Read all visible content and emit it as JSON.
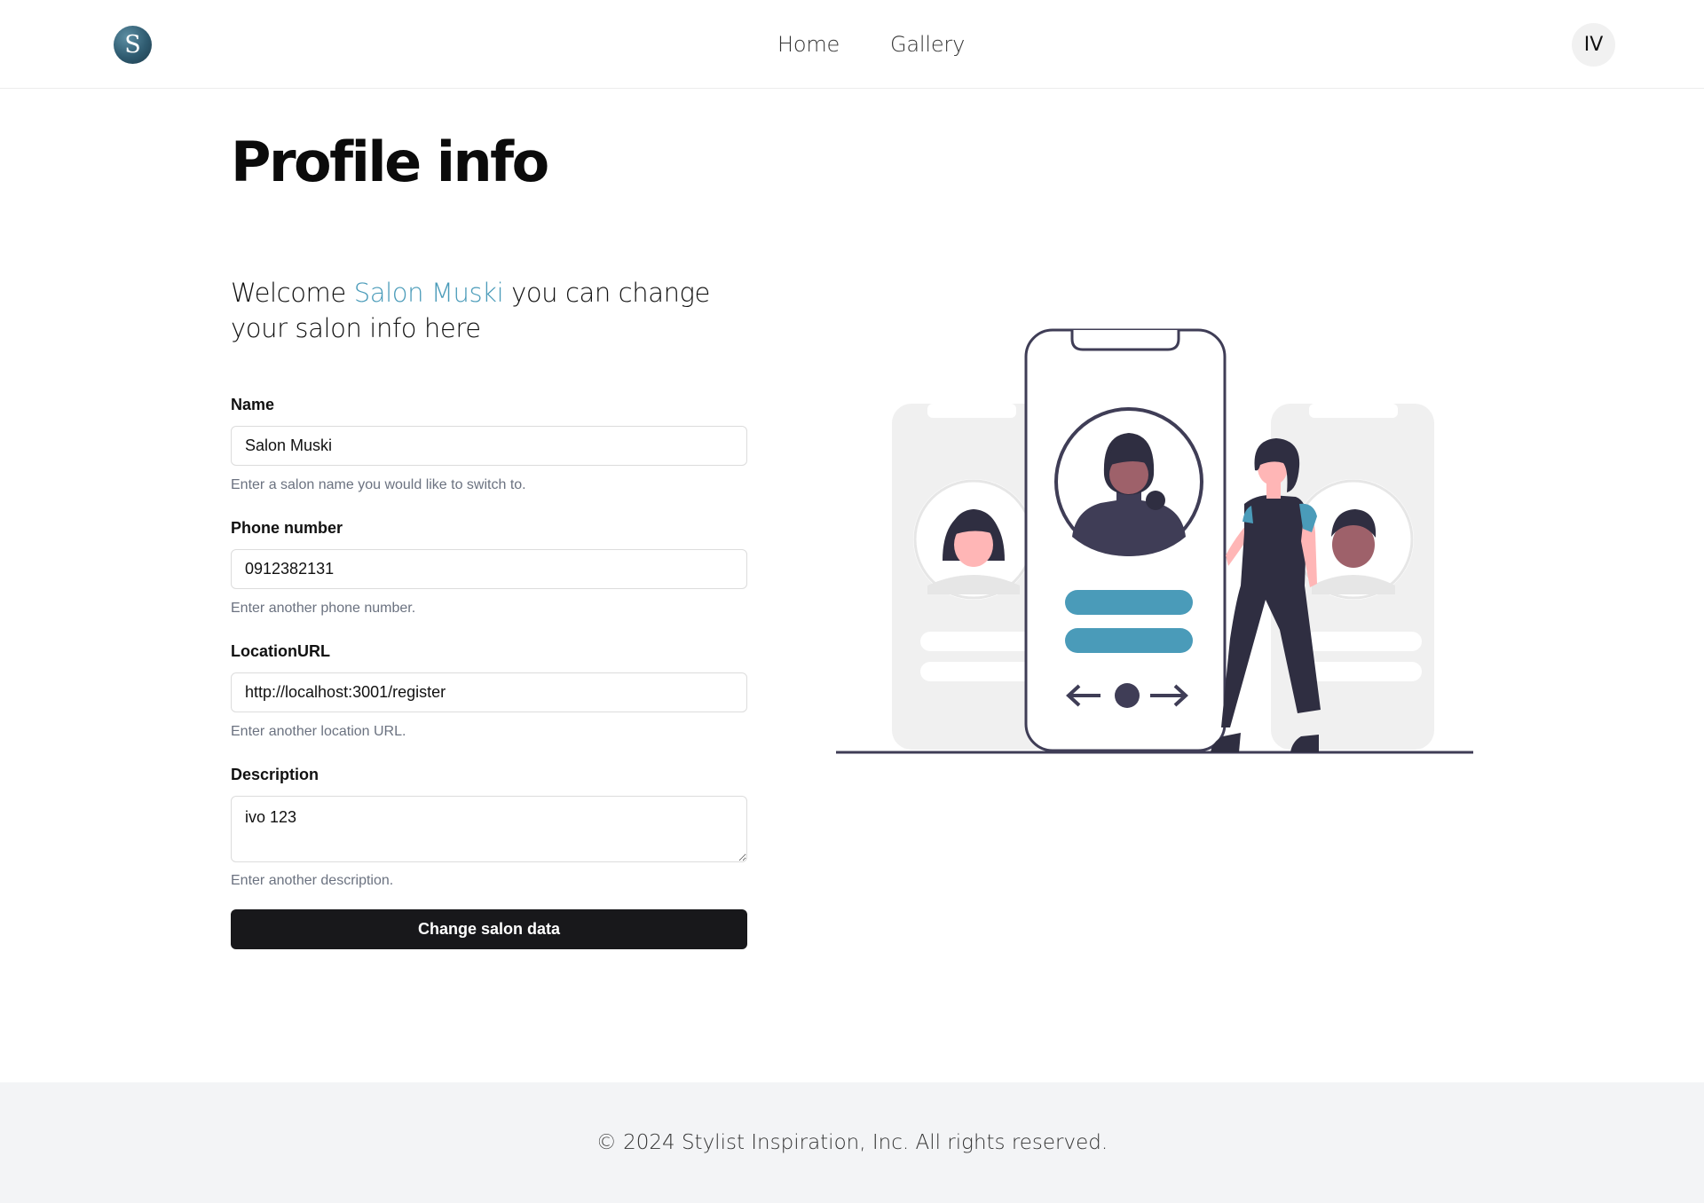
{
  "header": {
    "logo_letter": "S",
    "nav": [
      {
        "label": "Home"
      },
      {
        "label": "Gallery"
      }
    ],
    "user_initials": "IV"
  },
  "main": {
    "title": "Profile info",
    "welcome": {
      "prefix": "Welcome",
      "salon_name": "Salon Muski",
      "suffix": "you can change your salon info here"
    },
    "form": {
      "name": {
        "label": "Name",
        "value": "Salon Muski",
        "hint": "Enter a salon name you would like to switch to."
      },
      "phone": {
        "label": "Phone number",
        "value": "0912382131",
        "hint": "Enter another phone number."
      },
      "location": {
        "label": "LocationURL",
        "value": "http://localhost:3001/register",
        "hint": "Enter another location URL."
      },
      "description": {
        "label": "Description",
        "value": "ivo 123",
        "hint": "Enter another description."
      },
      "submit_label": "Change salon data"
    },
    "illustration": {
      "icon": "profile-phone-illustration",
      "accent_color": "#4a9bb9",
      "dark_color": "#2f2e41",
      "skin_color": "#ffb6b6"
    }
  },
  "footer": {
    "copyright": "© 2024 Stylist Inspiration, Inc. All rights reserved."
  },
  "colors": {
    "accent": "#4a9bb9",
    "button": "#18181b",
    "footer_bg": "#f3f4f6"
  }
}
